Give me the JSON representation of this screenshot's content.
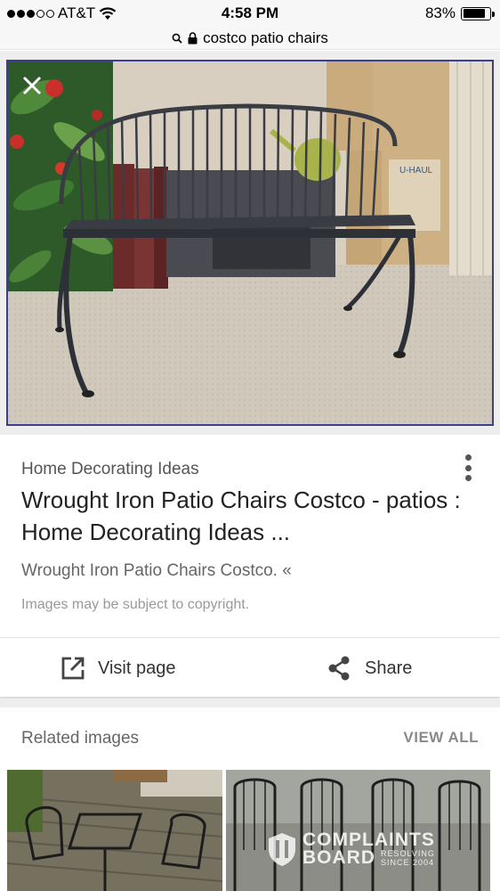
{
  "status_bar": {
    "carrier": "AT&T",
    "signal_bars_filled": 3,
    "signal_bars_total": 5,
    "time": "4:58 PM",
    "battery_percent": "83%",
    "battery_level": 0.83
  },
  "url_bar": {
    "query": "costco patio chairs"
  },
  "result": {
    "source": "Home Decorating Ideas",
    "title": "Wrought Iron Patio Chairs Costco - patios : Home Decorating Ideas ...",
    "snippet": "Wrought Iron Patio Chairs Costco. «",
    "copyright": "Images may be subject to copyright.",
    "visit_label": "Visit page",
    "share_label": "Share"
  },
  "related": {
    "title": "Related images",
    "view_all": "VIEW ALL"
  },
  "watermark": {
    "line1": "COMPLAINTS",
    "line2": "BOARD",
    "tag1": "RESOLVING",
    "tag2": "SINCE 2004"
  },
  "icons": {
    "close": "close-icon",
    "search": "search-icon",
    "lock": "lock-icon",
    "wifi": "wifi-icon",
    "more": "more-vert-icon",
    "open_in_new": "open-in-new-icon",
    "share": "share-icon"
  }
}
